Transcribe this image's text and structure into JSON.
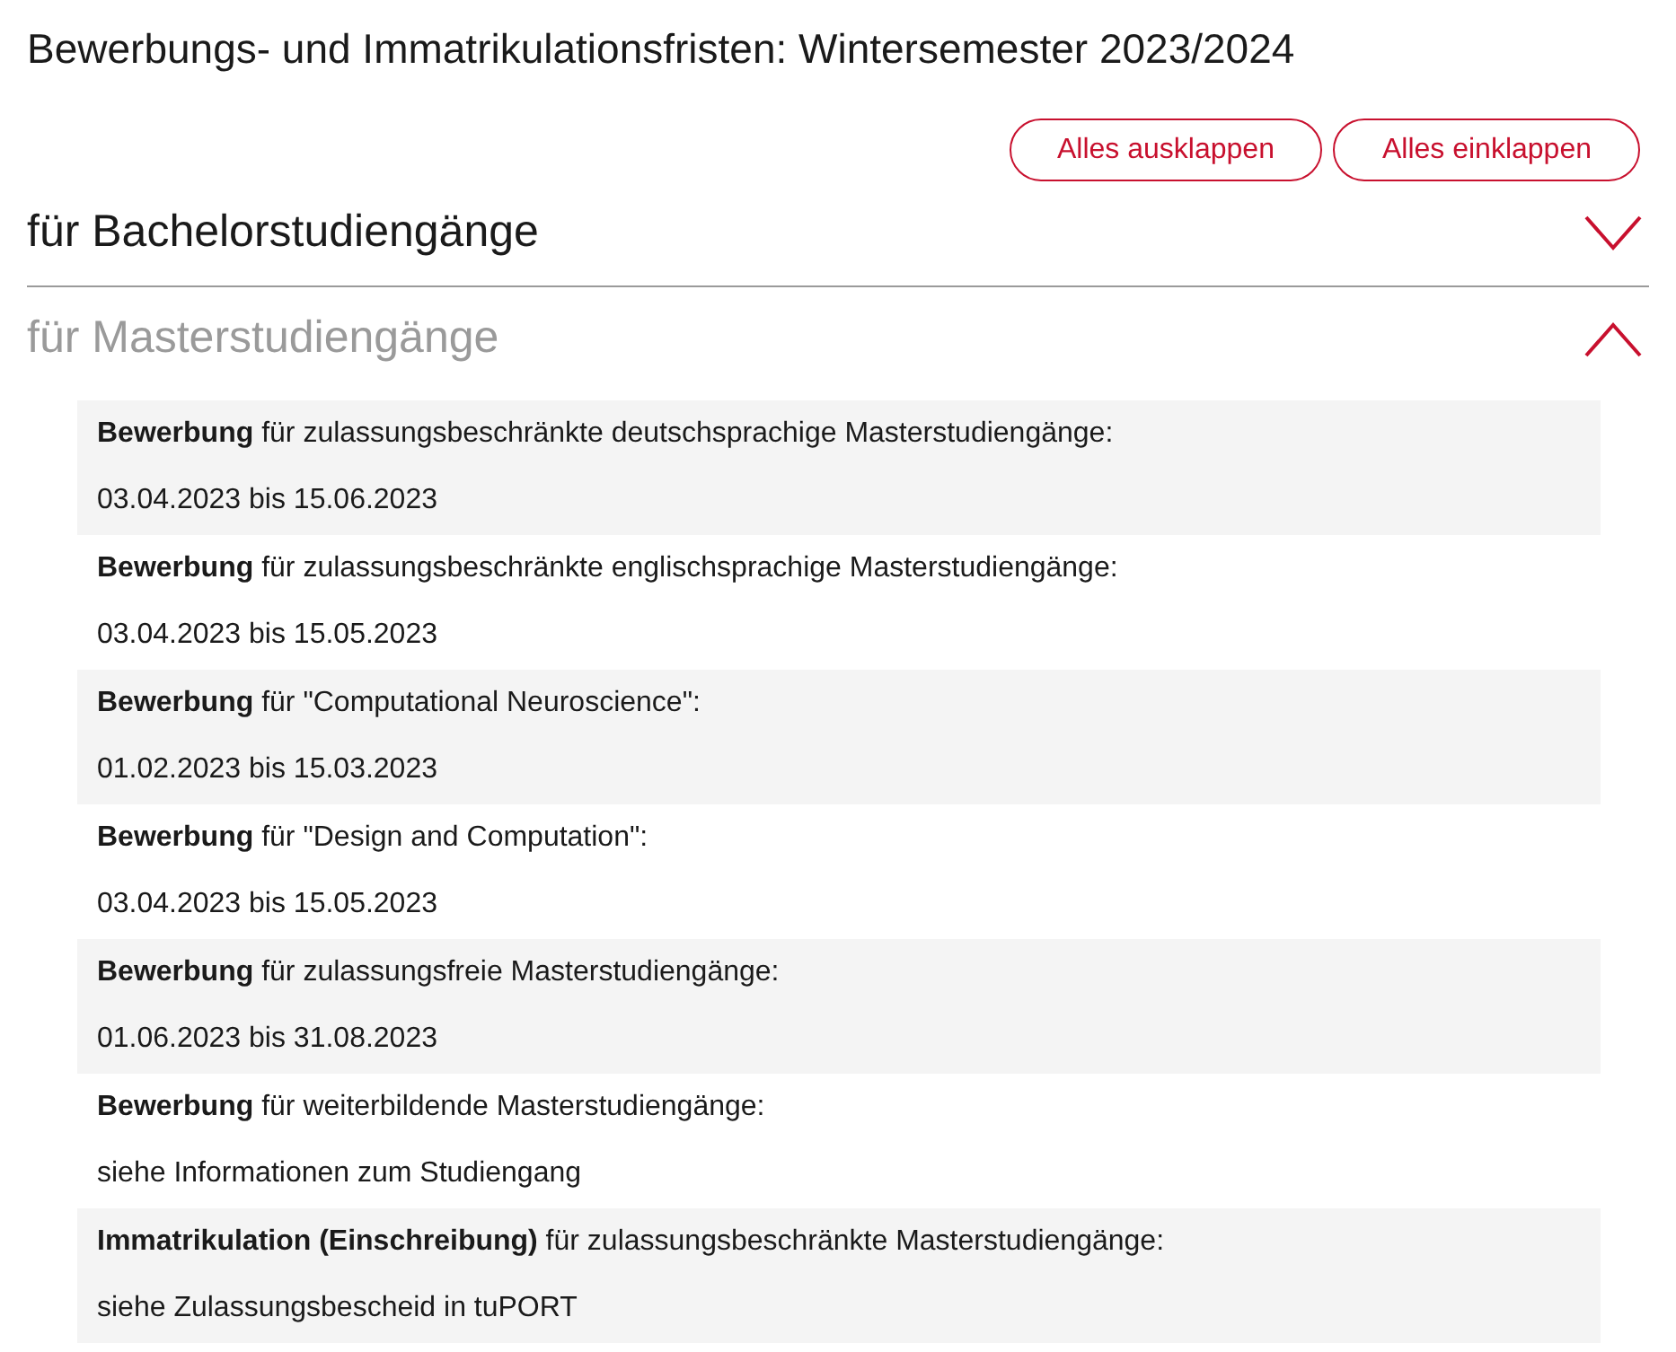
{
  "page": {
    "title": "Bewerbungs- und Immatrikulationsfristen: Wintersemester 2023/2024"
  },
  "toolbar": {
    "buttons": [
      "Alles ausklappen",
      "Alles einklappen"
    ]
  },
  "sections": [
    {
      "title": "für Bachelorstudiengänge",
      "expanded": false
    },
    {
      "title": "für Masterstudiengänge",
      "expanded": true,
      "entries": [
        {
          "heading": "**Bewerbung** für zulassungsbeschränkte deutschsprachige Masterstudiengänge:",
          "detail": "03.04.2023 bis 15.06.2023"
        },
        {
          "heading": "**Bewerbung** für zulassungsbeschränkte englischsprachige Masterstudiengänge:",
          "detail": "03.04.2023 bis 15.05.2023"
        },
        {
          "heading": "**Bewerbung** für \"Computational Neuroscience\":",
          "detail": "01.02.2023 bis 15.03.2023"
        },
        {
          "heading": "**Bewerbung** für \"Design and Computation\":",
          "detail": "03.04.2023 bis 15.05.2023"
        },
        {
          "heading": "**Bewerbung** für zulassungsfreie Masterstudiengänge:",
          "detail": "01.06.2023 bis 31.08.2023"
        },
        {
          "heading": "**Bewerbung** für weiterbildende Masterstudiengänge:",
          "detail": "siehe Informationen zum Studiengang"
        },
        {
          "heading": "**Immatrikulation (Einschreibung)** für zulassungsbeschränkte Masterstudiengänge:",
          "detail": "siehe Zulassungsbescheid in tuPORT"
        }
      ]
    }
  ]
}
